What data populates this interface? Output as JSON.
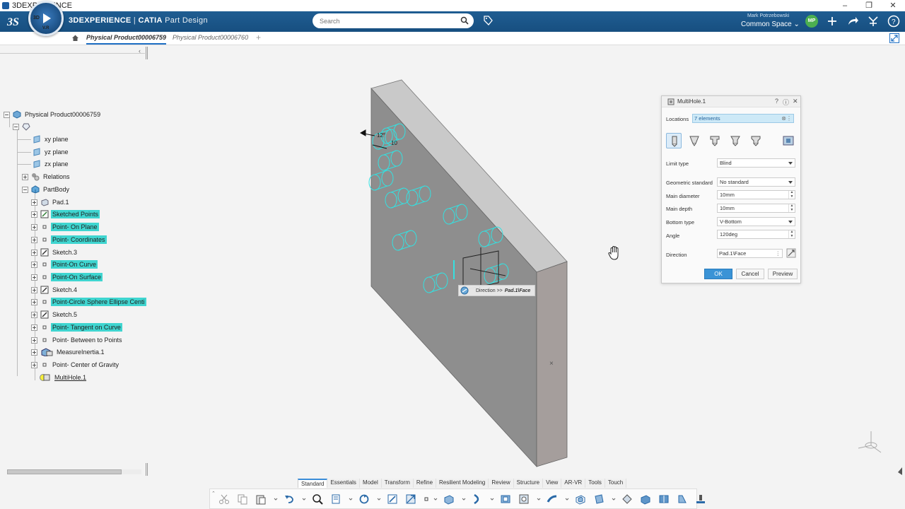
{
  "window": {
    "title": "3DEXPERIENCE",
    "minimize": "–",
    "maximize": "❐",
    "close": "✕"
  },
  "header": {
    "brand": "3DEXPERIENCE",
    "separator": " | ",
    "product": "CATIA",
    "module": " Part Design",
    "compass_3d": "3D",
    "compass_vr": "V.R",
    "search_placeholder": "Search",
    "user_name": "Mark Potrzebowski",
    "space": "Common Space",
    "space_chevron": "⌄",
    "avatar_initials": "MP",
    "colors": {
      "header_bg": "#1f5d92",
      "accent": "#1e6fc4"
    }
  },
  "tabs": [
    {
      "label": "Physical Product00006759",
      "active": true
    },
    {
      "label": "Physical Product00006760",
      "active": false
    }
  ],
  "tab_add": "+",
  "tree_collapse": "‹",
  "tree": {
    "root": "Physical Product00006759",
    "items": [
      {
        "label": "xy plane",
        "highlight": false
      },
      {
        "label": "yz plane",
        "highlight": false
      },
      {
        "label": "zx plane",
        "highlight": false
      },
      {
        "label": "Relations",
        "highlight": false
      },
      {
        "label": "PartBody",
        "highlight": false
      },
      {
        "label": "Pad.1",
        "highlight": false
      },
      {
        "label": "Sketched Points",
        "highlight": true
      },
      {
        "label": "Point- On Plane",
        "highlight": true
      },
      {
        "label": "Point- Coordinates",
        "highlight": true
      },
      {
        "label": "Sketch.3",
        "highlight": false
      },
      {
        "label": "Point-On Curve",
        "highlight": true
      },
      {
        "label": "Point-On Surface",
        "highlight": true
      },
      {
        "label": "Sketch.4",
        "highlight": false
      },
      {
        "label": "Point-Circle Sphere Ellipse Centi",
        "highlight": true
      },
      {
        "label": "Sketch.5",
        "highlight": false
      },
      {
        "label": "Point- Tangent on Curve",
        "highlight": true
      },
      {
        "label": "Point- Between to Points",
        "highlight": false
      },
      {
        "label": "MeasureInertia.1",
        "highlight": false
      },
      {
        "label": "Point- Center of Gravity",
        "highlight": false
      },
      {
        "label": "MultiHole.1",
        "highlight": false
      }
    ]
  },
  "viewport": {
    "direction_tip_label": "Direction >>",
    "direction_tip_value": "Pad.1\\Face",
    "center_mark": "×",
    "dimension_label_1": "12°",
    "dimension_label_2": "10",
    "highlight_color": "#3fd5d0"
  },
  "dialog": {
    "title": "MultiHole.1",
    "help": "?",
    "info": "ⓘ",
    "close": "✕",
    "locations_label": "Locations",
    "locations_value": "7 elements",
    "locations_clear": "⊗",
    "menu_dots": "⋮",
    "limit_type_label": "Limit type",
    "limit_type_value": "Blind",
    "geometric_standard_label": "Geometric standard",
    "geometric_standard_value": "No standard",
    "main_diameter_label": "Main diameter",
    "main_diameter_value": "10mm",
    "main_depth_label": "Main depth",
    "main_depth_value": "10mm",
    "bottom_type_label": "Bottom type",
    "bottom_type_value": "V-Bottom",
    "angle_label": "Angle",
    "angle_value": "120deg",
    "direction_label": "Direction",
    "direction_value": "Pad.1\\Face",
    "spin_up": "▲",
    "spin_down": "▼",
    "ok": "OK",
    "cancel": "Cancel",
    "preview": "Preview"
  },
  "action_bar": {
    "collapse": "⌃",
    "sections": [
      "Standard",
      "Essentials",
      "Model",
      "Transform",
      "Refine",
      "Resilient Modeling",
      "Review",
      "Structure",
      "View",
      "AR-VR",
      "Tools",
      "Touch"
    ],
    "active_section": "Standard"
  }
}
